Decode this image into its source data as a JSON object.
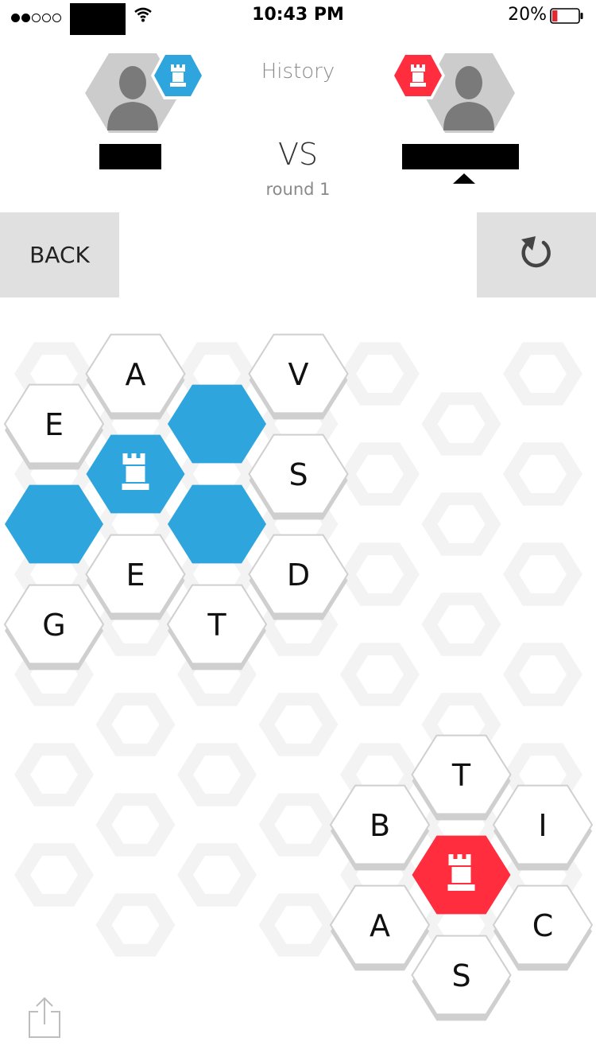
{
  "status_bar": {
    "signal_bars": 5,
    "signal_filled": 2,
    "time": "10:43 PM",
    "battery": "20%",
    "battery_level": 0.2
  },
  "header": {
    "history_label": "History",
    "vs_label": "VS",
    "round_label": "round 1",
    "player_left_color": "#2ea6dd",
    "player_right_color": "#ff2d3d"
  },
  "controls": {
    "back_label": "BACK",
    "reset_icon": "rotate-left-icon"
  },
  "board": {
    "blue_color": "#2ea6dd",
    "red_color": "#ff2d3d",
    "tiles": [
      {
        "id": "t1",
        "col": 1,
        "row": 0,
        "letter": "A",
        "state": "letter"
      },
      {
        "id": "t2",
        "col": 3,
        "row": 0,
        "letter": "V",
        "state": "letter"
      },
      {
        "id": "t3",
        "col": 0,
        "row": 1,
        "letter": "E",
        "state": "letter"
      },
      {
        "id": "t4",
        "col": 2,
        "row": 1,
        "letter": "",
        "state": "blue"
      },
      {
        "id": "t5",
        "col": 1,
        "row": 2,
        "letter": "",
        "state": "blue-base"
      },
      {
        "id": "t6",
        "col": 3,
        "row": 2,
        "letter": "S",
        "state": "letter"
      },
      {
        "id": "t7",
        "col": 0,
        "row": 3,
        "letter": "",
        "state": "blue"
      },
      {
        "id": "t8",
        "col": 2,
        "row": 3,
        "letter": "",
        "state": "blue"
      },
      {
        "id": "t9",
        "col": 1,
        "row": 4,
        "letter": "E",
        "state": "letter"
      },
      {
        "id": "t10",
        "col": 3,
        "row": 4,
        "letter": "D",
        "state": "letter"
      },
      {
        "id": "t11",
        "col": 0,
        "row": 5,
        "letter": "G",
        "state": "letter"
      },
      {
        "id": "t12",
        "col": 2,
        "row": 5,
        "letter": "T",
        "state": "letter"
      },
      {
        "id": "t13",
        "col": 5,
        "row": 8,
        "letter": "T",
        "state": "letter"
      },
      {
        "id": "t14",
        "col": 4,
        "row": 9,
        "letter": "B",
        "state": "letter"
      },
      {
        "id": "t15",
        "col": 6,
        "row": 9,
        "letter": "I",
        "state": "letter"
      },
      {
        "id": "t16",
        "col": 5,
        "row": 10,
        "letter": "",
        "state": "red-base"
      },
      {
        "id": "t17",
        "col": 4,
        "row": 11,
        "letter": "A",
        "state": "letter"
      },
      {
        "id": "t18",
        "col": 6,
        "row": 11,
        "letter": "C",
        "state": "letter"
      },
      {
        "id": "t19",
        "col": 5,
        "row": 12,
        "letter": "S",
        "state": "letter"
      }
    ]
  },
  "footer": {
    "share_icon": "share-icon"
  }
}
